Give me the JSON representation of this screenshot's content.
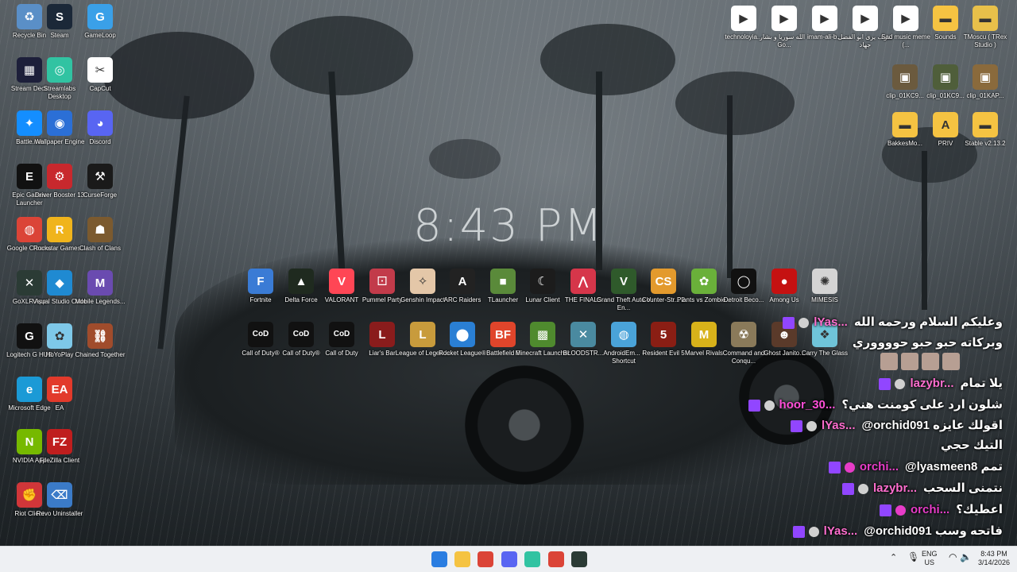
{
  "clock": "8:43 PM",
  "icons": [
    {
      "label": "Recycle Bin",
      "glyph": "♻",
      "color": "#5a8fc7"
    },
    {
      "label": "Steam",
      "glyph": "S",
      "color": "#1b2838"
    },
    {
      "label": "GameLoop",
      "glyph": "G",
      "color": "#3aa0e8"
    },
    {
      "label": "Stream Deck",
      "glyph": "▦",
      "color": "#1d1f3a"
    },
    {
      "label": "Streamlabs Desktop",
      "glyph": "◎",
      "color": "#31c3a2"
    },
    {
      "label": "CapCut",
      "glyph": "✂",
      "color": "#ffffff"
    },
    {
      "label": "Battle.net",
      "glyph": "✦",
      "color": "#148eff"
    },
    {
      "label": "Wallpaper Engine",
      "glyph": "◉",
      "color": "#2b6fd6"
    },
    {
      "label": "Discord",
      "glyph": "◕",
      "color": "#5865f2"
    },
    {
      "label": "Epic Games Launcher",
      "glyph": "E",
      "color": "#111111"
    },
    {
      "label": "Driver Booster 13",
      "glyph": "⚙",
      "color": "#c8282d"
    },
    {
      "label": "CurseForge",
      "glyph": "⚒",
      "color": "#1a1a1a"
    },
    {
      "label": "Google Chrome",
      "glyph": "◍",
      "color": "#db4437"
    },
    {
      "label": "Rockstar Games...",
      "glyph": "R",
      "color": "#f0b41c"
    },
    {
      "label": "Clash of Clans",
      "glyph": "☗",
      "color": "#7b5a2f"
    },
    {
      "label": "GoXLR App",
      "glyph": "✕",
      "color": "#2b3b35"
    },
    {
      "label": "Visual Studio Code",
      "glyph": "◆",
      "color": "#1f8ad2"
    },
    {
      "label": "Mobile Legends...",
      "glyph": "M",
      "color": "#6a4bb0"
    },
    {
      "label": "Logitech G HUB",
      "glyph": "G",
      "color": "#111111"
    },
    {
      "label": "HoYoPlay",
      "glyph": "✿",
      "color": "#7ec8e8"
    },
    {
      "label": "Chained Together",
      "glyph": "⛓",
      "color": "#a04c2c"
    },
    {
      "label": "Microsoft Edge",
      "glyph": "e",
      "color": "#1b9ad6"
    },
    {
      "label": "EA",
      "glyph": "EA",
      "color": "#e23a2b"
    },
    {
      "label": "NVIDIA App",
      "glyph": "N",
      "color": "#76b900"
    },
    {
      "label": "FileZilla Client",
      "glyph": "FZ",
      "color": "#bf1e1e"
    },
    {
      "label": "Riot Client",
      "glyph": "✊",
      "color": "#d13639"
    },
    {
      "label": "Revo Uninstaller",
      "glyph": "⌫",
      "color": "#3b7bc8"
    },
    {
      "label": "technoloyia...",
      "glyph": "▶",
      "color": "#ffffff"
    },
    {
      "label": "الله سوريا و بشار - Go...",
      "glyph": "▶",
      "color": "#ffffff"
    },
    {
      "label": "imam-ali-b...",
      "glyph": "▶",
      "color": "#ffffff"
    },
    {
      "label": "سوف يرى ابو الفضل جهاد",
      "glyph": "▶",
      "color": "#ffffff"
    },
    {
      "label": "Sad music meme (...",
      "glyph": "▶",
      "color": "#ffffff"
    },
    {
      "label": "Sounds",
      "glyph": "▬",
      "color": "#f5c342"
    },
    {
      "label": "TMoscu ( TRex Studio )",
      "glyph": "▬",
      "color": "#e8c04a"
    },
    {
      "label": "clip_01KC9...",
      "glyph": "▣",
      "color": "#6b5a3e"
    },
    {
      "label": "clip_01KC9...",
      "glyph": "▣",
      "color": "#4f5e3a"
    },
    {
      "label": "clip_01KAP...",
      "glyph": "▣",
      "color": "#8a6a3c"
    },
    {
      "label": "BakkesMo...",
      "glyph": "▬",
      "color": "#f5c342"
    },
    {
      "label": "PRIV",
      "glyph": "A",
      "color": "#f5c342"
    },
    {
      "label": "Stable v2.13.2",
      "glyph": "▬",
      "color": "#f5c342"
    },
    {
      "label": "Fortnite",
      "glyph": "F",
      "color": "#3a7bd5"
    },
    {
      "label": "Delta Force",
      "glyph": "▲",
      "color": "#1f2a1f"
    },
    {
      "label": "VALORANT",
      "glyph": "V",
      "color": "#ff4655"
    },
    {
      "label": "Pummel Party",
      "glyph": "⚀",
      "color": "#c23b4a"
    },
    {
      "label": "Genshin Impact",
      "glyph": "✧",
      "color": "#e4c7a8"
    },
    {
      "label": "ARC Raiders",
      "glyph": "A",
      "color": "#222222"
    },
    {
      "label": "TLauncher",
      "glyph": "■",
      "color": "#5a8a3a"
    },
    {
      "label": "Lunar Client",
      "glyph": "☾",
      "color": "#1c1c1c"
    },
    {
      "label": "THE FINALS",
      "glyph": "⋀",
      "color": "#d6364a"
    },
    {
      "label": "Grand Theft Auto V En...",
      "glyph": "V",
      "color": "#2f5a2b"
    },
    {
      "label": "Counter-Str... 2",
      "glyph": "CS",
      "color": "#e39a2d"
    },
    {
      "label": "Plants vs Zombie...",
      "glyph": "✿",
      "color": "#6ab03a"
    },
    {
      "label": "Detroit Beco...",
      "glyph": "◯",
      "color": "#111111"
    },
    {
      "label": "Among Us",
      "glyph": "●",
      "color": "#c51111"
    },
    {
      "label": "MIMESIS",
      "glyph": "✺",
      "color": "#d4d4d4"
    },
    {
      "label": "Call of Duty®",
      "glyph": "CoD",
      "color": "#111111"
    },
    {
      "label": "Call of Duty®",
      "glyph": "CoD",
      "color": "#111111"
    },
    {
      "label": "Call of Duty",
      "glyph": "CoD",
      "color": "#111111"
    },
    {
      "label": "Liar's Bar",
      "glyph": "L",
      "color": "#8a1c1c"
    },
    {
      "label": "League of Legends",
      "glyph": "L",
      "color": "#c89b3c"
    },
    {
      "label": "Rocket League®",
      "glyph": "⬤",
      "color": "#2a7fd4"
    },
    {
      "label": "Battlefield 6",
      "glyph": "BF",
      "color": "#e0452b"
    },
    {
      "label": "Minecraft Launcher",
      "glyph": "▩",
      "color": "#4f8a2e"
    },
    {
      "label": "BLOODSTR...",
      "glyph": "✕",
      "color": "#4a8aa0"
    },
    {
      "label": "AndroidEm... - Shortcut",
      "glyph": "◍",
      "color": "#4aa3d9"
    },
    {
      "label": "Resident Evil 5",
      "glyph": "5",
      "color": "#8a1e14"
    },
    {
      "label": "Marvel Rivals",
      "glyph": "M",
      "color": "#d8b21a"
    },
    {
      "label": "Command and Conqu...",
      "glyph": "☢",
      "color": "#8a7a5a"
    },
    {
      "label": "Ghost Janito...",
      "glyph": "☻",
      "color": "#5a3a2a"
    },
    {
      "label": "Carry The Glass",
      "glyph": "❖",
      "color": "#6fc4d9"
    }
  ],
  "chat": [
    {
      "name": "lYas...",
      "text": "وعليكم السلام ورحمه الله",
      "badge": "#d0d0d0"
    },
    {
      "name": "",
      "text": "وبركاته حبو حبو حووووري",
      "badge": ""
    },
    {
      "name": "lazybr...",
      "text": "يلا تمام",
      "badge": "#d0d0d0"
    },
    {
      "name": "hoor_30...",
      "text": "شلون ارد على كومنت هني؟",
      "badge": ""
    },
    {
      "name": "lYas...",
      "text": "@orchid091 اقولك عايزه",
      "badge": "#d0d0d0"
    },
    {
      "name": "",
      "text": "التيك حجي",
      "badge": ""
    },
    {
      "name": "orchi...",
      "text": "@lyasmeen8 تمم",
      "badge": "#e73cc8"
    },
    {
      "name": "lazybr...",
      "text": "نتمنى السحب",
      "badge": "#d0d0d0"
    },
    {
      "name": "orchi...",
      "text": "اعطيك؟",
      "badge": "#e73cc8"
    },
    {
      "name": "lYas...",
      "text": "@orchid091 فاتحه وسب",
      "badge": "#d0d0d0"
    }
  ],
  "taskbar": {
    "apps": [
      {
        "name": "start-icon",
        "color": "#2a7de1"
      },
      {
        "name": "file-explorer-icon",
        "color": "#f5c342"
      },
      {
        "name": "chrome-icon",
        "color": "#db4437"
      },
      {
        "name": "discord-icon",
        "color": "#5865f2"
      },
      {
        "name": "streamlabs-icon",
        "color": "#31c3a2"
      },
      {
        "name": "chrome-profile-icon",
        "color": "#db4437"
      },
      {
        "name": "goxlr-icon",
        "color": "#2b3b35"
      }
    ],
    "lang_top": "ENG",
    "lang_bottom": "US",
    "time": "8:43 PM",
    "date": "3/14/2026"
  }
}
